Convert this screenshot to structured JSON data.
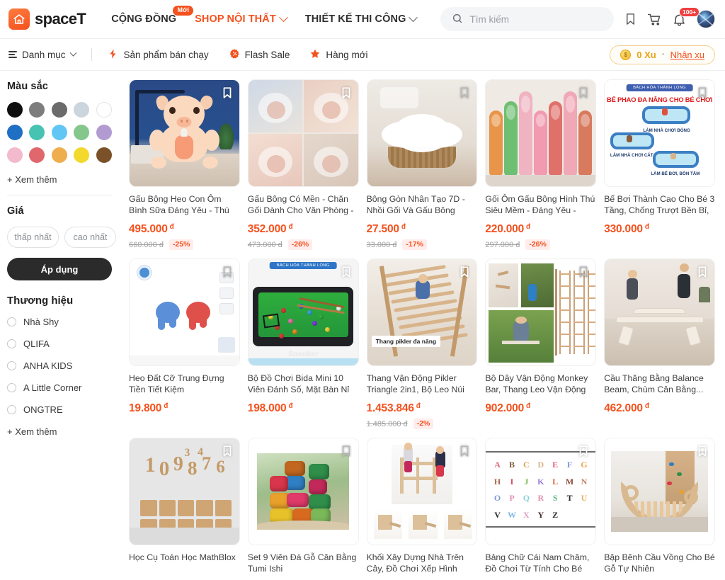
{
  "header": {
    "logo_text": "spaceT",
    "logo_icon": "house-icon",
    "nav": [
      {
        "label": "CỘNG ĐỒNG",
        "badge": "Mới",
        "accent": false,
        "caret": false
      },
      {
        "label": "SHOP NỘI THẤT",
        "badge": "",
        "accent": true,
        "caret": true
      },
      {
        "label": "THIẾT KẾ THI CÔNG",
        "badge": "",
        "accent": false,
        "caret": true
      }
    ],
    "search": {
      "placeholder": "Tìm kiếm",
      "value": "",
      "icon": "search-icon"
    },
    "icons": [
      {
        "name": "bookmark-icon"
      },
      {
        "name": "cart-icon"
      },
      {
        "name": "notification-icon",
        "badge": "100+"
      },
      {
        "name": "avatar"
      }
    ]
  },
  "subnav": {
    "categories_label": "Danh mục",
    "items": [
      {
        "label": "Sản phẩm bán chạy",
        "icon": "lightning-icon"
      },
      {
        "label": "Flash Sale",
        "icon": "flash-sale-icon"
      },
      {
        "label": "Hàng mới",
        "icon": "star-icon"
      }
    ],
    "coin": {
      "icon": "coin-icon",
      "amount": "0 Xu",
      "separator": "•",
      "link": "Nhận xu"
    }
  },
  "sidebar": {
    "color_title": "Màu sắc",
    "colors": [
      "#0f0f0f",
      "#7d7d7d",
      "#6b6b6b",
      "#cbd5dd",
      "#ffffff",
      "#1f6fc4",
      "#46c3b2",
      "#62c6f5",
      "#84c68c",
      "#b29bd1",
      "#f3b9cd",
      "#e0676c",
      "#efae4d",
      "#f2d92b",
      "#7a5128"
    ],
    "color_more": "+ Xem thêm",
    "price_title": "Giá",
    "price_min_placeholder": "thấp nhất",
    "price_max_placeholder": "cao nhất",
    "price_min_value": "",
    "price_max_value": "",
    "apply_label": "Áp dụng",
    "brand_title": "Thương hiệu",
    "brands": [
      {
        "label": "Nhà Shy",
        "checked": false
      },
      {
        "label": "QLIFA",
        "checked": false
      },
      {
        "label": "ANHA KIDS",
        "checked": false
      },
      {
        "label": "A Little Corner",
        "checked": false
      },
      {
        "label": "ONGTRE",
        "checked": false
      }
    ],
    "brand_more": "+ Xem thêm"
  },
  "products": [
    {
      "title": "Gấu Bông Heo Con Ôm Bình Sữa Đáng Yêu - Thú Nhồi Bôn...",
      "price": "495.000",
      "currency": "đ",
      "old_price": "660.000 đ",
      "discount": "-25%",
      "bookmarked": true,
      "art": "pig"
    },
    {
      "title": "Gấu Bông Có Mền - Chăn Gối Dành Cho Văn Phòng - Bé Đi...",
      "price": "352.000",
      "currency": "đ",
      "old_price": "473.000 đ",
      "discount": "-26%",
      "bookmarked": true,
      "art": "collage"
    },
    {
      "title": "Bông Gòn Nhân Tạo 7D - Nhồi Gối Và Gấu Bông",
      "price": "27.500",
      "currency": "đ",
      "old_price": "33.000 đ",
      "discount": "-17%",
      "bookmarked": false,
      "art": "cloud"
    },
    {
      "title": "Gối Ôm Gấu Bông Hình Thú Siêu Mềm - Đáng Yêu - Nhiều...",
      "price": "220.000",
      "currency": "đ",
      "old_price": "297.000 đ",
      "discount": "-26%",
      "bookmarked": false,
      "art": "plushrow"
    },
    {
      "title": "Bể Bơi Thành Cao Cho Bé 3 Tầng, Chống Trượt Bền Bỉ, An...",
      "price": "330.000",
      "currency": "đ",
      "old_price": "",
      "discount": "",
      "bookmarked": false,
      "art": "pool"
    },
    {
      "title": "Heo Đất Cỡ Trung Đựng Tiền Tiết Kiệm",
      "price": "19.800",
      "currency": "đ",
      "old_price": "",
      "discount": "",
      "bookmarked": false,
      "art": "piggy"
    },
    {
      "title": "Bộ Đồ Chơi Bida Mini 10 Viên Đánh Số, Mặt Bàn Nỉ Không...",
      "price": "198.000",
      "currency": "đ",
      "old_price": "",
      "discount": "",
      "bookmarked": true,
      "art": "snooker"
    },
    {
      "title": "Thang Vận Động Pikler Triangle 2in1, Bộ Leo Núi Tre...",
      "price": "1.453.846",
      "currency": "đ",
      "old_price": "1.485.000 đ",
      "discount": "-2%",
      "bookmarked": true,
      "art": "pikler"
    },
    {
      "title": "Bộ Dây Vận Động Monkey Bar, Thang Leo Vận Động Cho Bé",
      "price": "902.000",
      "currency": "đ",
      "old_price": "",
      "discount": "",
      "bookmarked": false,
      "art": "monkey"
    },
    {
      "title": "Cầu Thăng Bằng Balance Beam, Chùm Cân Bằng...",
      "price": "462.000",
      "currency": "đ",
      "old_price": "",
      "discount": "",
      "bookmarked": true,
      "art": "beam"
    },
    {
      "title": "Học Cụ Toán Học MathBlox",
      "price": "",
      "currency": "",
      "old_price": "",
      "discount": "",
      "bookmarked": true,
      "art": "math"
    },
    {
      "title": "Set 9 Viên Đá Gỗ Cân Bằng Tumi Ishi",
      "price": "",
      "currency": "",
      "old_price": "",
      "discount": "",
      "bookmarked": false,
      "art": "tumi"
    },
    {
      "title": "Khối Xây Dựng Nhà Trên Cây, Đồ Chơi Xếp Hình Sáng Tạo C...",
      "price": "",
      "currency": "",
      "old_price": "",
      "discount": "",
      "bookmarked": false,
      "art": "tree"
    },
    {
      "title": "Bảng Chữ Cái Nam Châm, Đồ Chơi Từ Tính Cho Bé Kết Hợp...",
      "price": "",
      "currency": "",
      "old_price": "",
      "discount": "",
      "bookmarked": true,
      "art": "alpha"
    },
    {
      "title": "Bập Bênh Cầu Vồng Cho Bé Gỗ Tự Nhiên",
      "price": "",
      "currency": "",
      "old_price": "",
      "discount": "",
      "bookmarked": true,
      "art": "rock"
    }
  ],
  "pool_ad": {
    "banner": "BÁCH HÓA THÀNH LONG",
    "title": "BỂ PHAO ĐA NĂNG CHO BÉ CHƠI",
    "captions": [
      "LÀM NHÀ CHƠI BÓNG",
      "LÀM NHÀ CHƠI CÁT",
      "LÀM BỂ BƠI, BỒN TẮM"
    ]
  },
  "snooker_ad": {
    "banner": "BÁCH HÓA THÀNH LONG",
    "brand": "Snooker"
  },
  "pikler_label": "Thang pikler đa năng",
  "alphabet": [
    "A",
    "B",
    "C",
    "D",
    "E",
    "F",
    "G",
    "H",
    "I",
    "J",
    "K",
    "L",
    "M",
    "N",
    "O",
    "P",
    "Q",
    "R",
    "S",
    "T",
    "U",
    "V",
    "W",
    "X",
    "Y",
    "Z"
  ],
  "colors": {
    "accent": "#F4511E",
    "price": "#F4511E",
    "badge_red": "#F03E3E",
    "coin": "#E8A317"
  }
}
